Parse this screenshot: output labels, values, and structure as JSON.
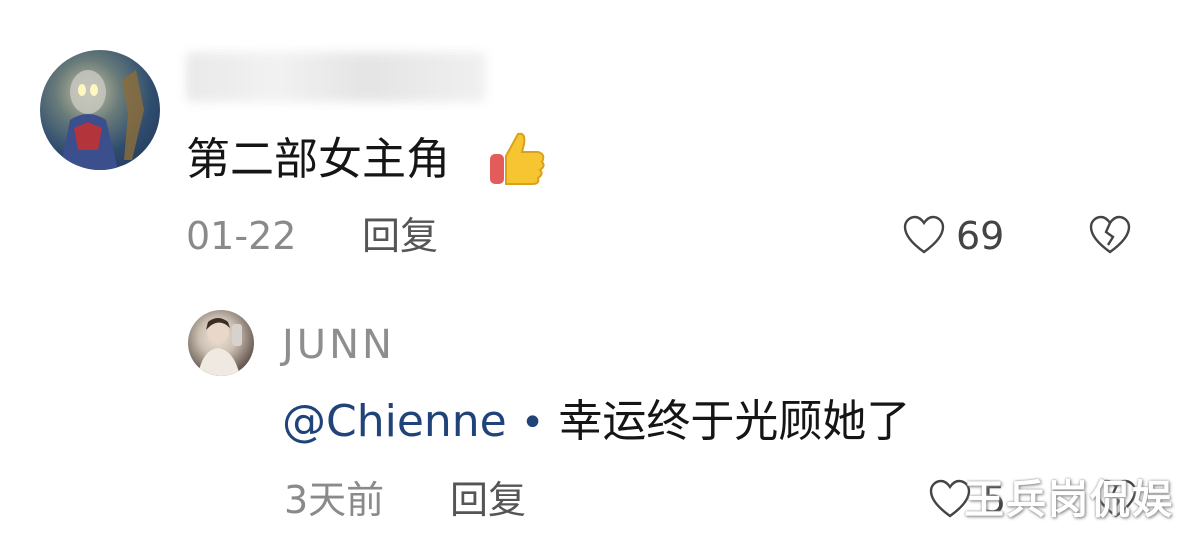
{
  "comment": {
    "text": "第二部女主角",
    "emoji": "thumbs-up-icon",
    "date": "01-22",
    "reply_label": "回复",
    "like_count": "69"
  },
  "reply": {
    "username": "JUNN",
    "mention": "@Chienne",
    "separator": "•",
    "text": "幸运终于光顾她了",
    "date": "3天前",
    "reply_label": "回复",
    "like_count_partial": "5"
  },
  "watermark": "王兵岗侃娱",
  "colors": {
    "mention": "#20447a",
    "meta_gray": "#8a8a8a",
    "text": "#151515"
  }
}
